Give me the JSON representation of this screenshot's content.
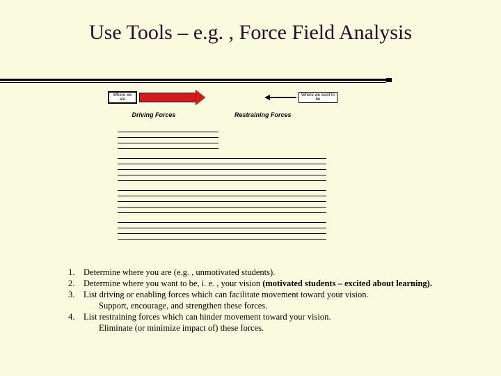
{
  "title": "Use Tools – e.g. , Force Field Analysis",
  "diagram": {
    "left_box": "Where we are",
    "right_box": "Where we want to be",
    "left_caption": "Driving Forces",
    "right_caption": "Restraining Forces"
  },
  "steps": [
    {
      "num": "1.",
      "text": "Determine where you are (e.g. , unmotivated students)."
    },
    {
      "num": "2.",
      "text_pre": "Determine where you want to be, i. e. , your vision ",
      "text_bold": "(motivated students – excited about learning)."
    },
    {
      "num": "3.",
      "text": "List driving or enabling forces which can facilitate movement toward your vision.",
      "sub": "Support, encourage, and strengthen these forces."
    },
    {
      "num": "4.",
      "text": "List restraining forces which can hinder movement toward your vision.",
      "sub": "Eliminate (or minimize impact of) these forces."
    }
  ]
}
